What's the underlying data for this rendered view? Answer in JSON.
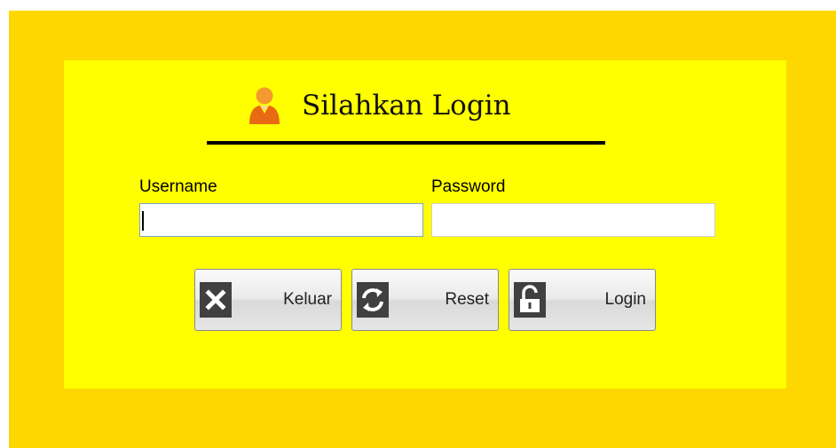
{
  "login": {
    "title": "Silahkan Login",
    "username_label": "Username",
    "password_label": "Password",
    "username_value": "",
    "password_value": ""
  },
  "buttons": {
    "keluar": "Keluar",
    "reset": "Reset",
    "login": "Login"
  },
  "icons": {
    "title": "user-icon",
    "keluar": "close-icon",
    "reset": "refresh-icon",
    "login": "unlock-icon"
  },
  "colors": {
    "frame": "#ffd700",
    "panel": "#ffff00",
    "user_icon": "#f07a1a",
    "button_icon": "#404040"
  }
}
